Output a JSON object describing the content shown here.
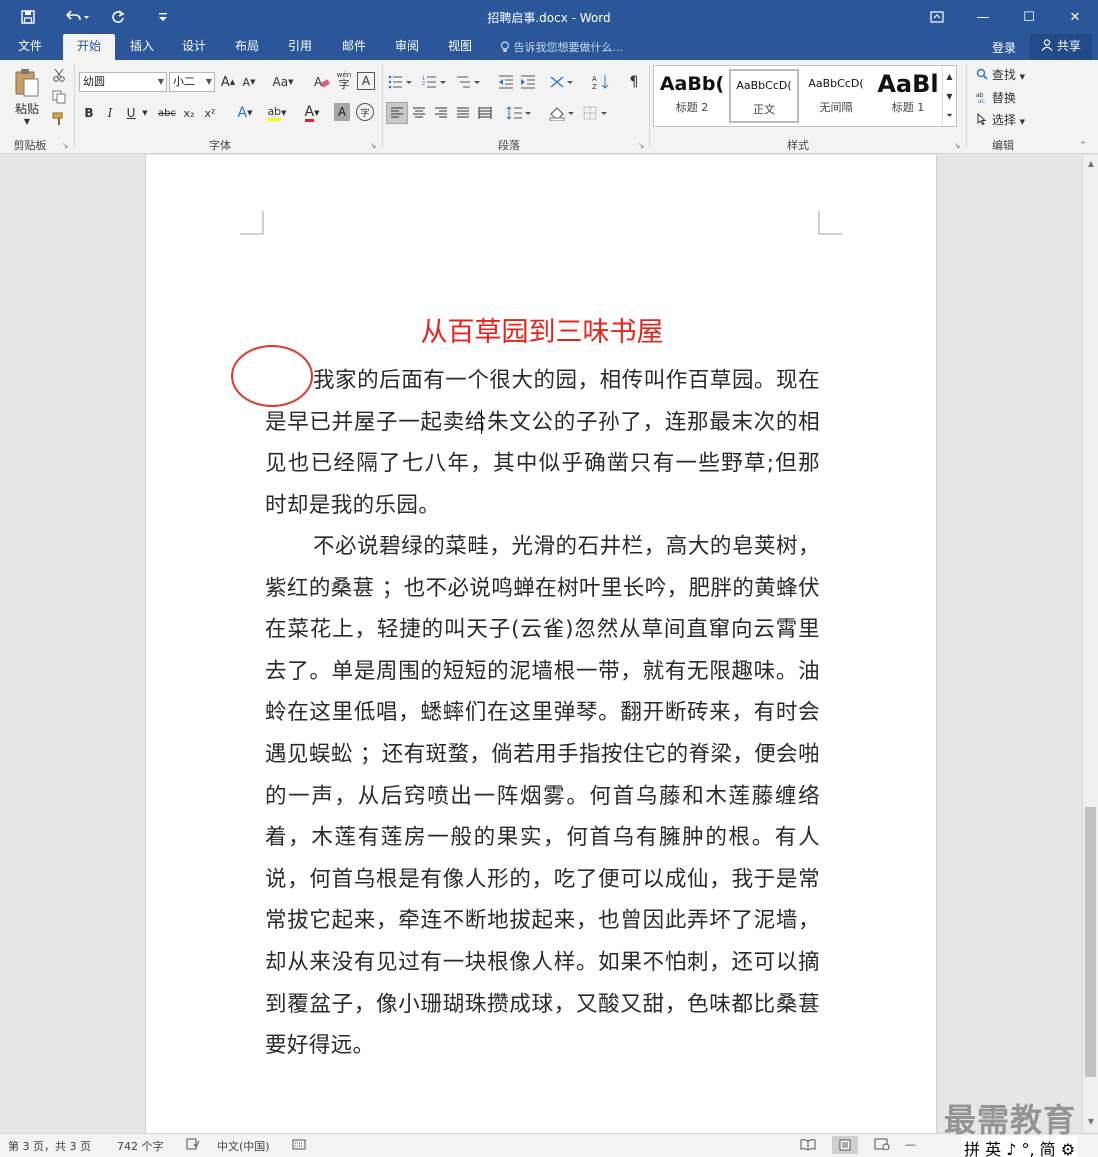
{
  "titlebar": {
    "title": "招聘启事.docx - Word",
    "save_icon": "save-icon",
    "undo_icon": "undo-icon",
    "redo_icon": "redo-icon",
    "customize_icon": "customize-qat-icon",
    "ribbon_display_icon": "ribbon-display-icon",
    "minimize": "—",
    "maximize": "☐",
    "close": "✕"
  },
  "tabs": [
    "文件",
    "开始",
    "插入",
    "设计",
    "布局",
    "引用",
    "邮件",
    "审阅",
    "视图"
  ],
  "active_tab": "开始",
  "tell_me": "告诉我您想要做什么...",
  "login": "登录",
  "share": "共享",
  "ribbon": {
    "clipboard": {
      "paste": "粘贴",
      "label": "剪贴板"
    },
    "font": {
      "font_name": "幼圆",
      "font_size": "小二",
      "label": "字体",
      "grow": "A",
      "shrink": "A",
      "case": "Aa",
      "bold": "B",
      "italic": "I",
      "underline": "U",
      "strike": "abc",
      "sub": "x₂",
      "sup": "x²",
      "effects": "A",
      "highlight": "ab",
      "color": "A",
      "shade": "A",
      "enclose": "字",
      "phonetic": "wén",
      "charborder": "A"
    },
    "paragraph": {
      "label": "段落"
    },
    "styles": {
      "label": "样式",
      "items": [
        {
          "preview": "AaBb(",
          "name": "标题 2"
        },
        {
          "preview": "AaBbCcD(",
          "name": "正文"
        },
        {
          "preview": "AaBbCcD(",
          "name": "无间隔"
        },
        {
          "preview": "AaBl",
          "name": "标题 1"
        }
      ]
    },
    "editing": {
      "find": "查找",
      "replace": "替换",
      "select": "选择",
      "label": "编辑"
    }
  },
  "document": {
    "title": "从百草园到三味书屋",
    "paragraphs": [
      "我家的后面有一个很大的园，相传叫作百草园。现在是早已并屋子一起卖给朱文公的子孙了，连那最末次的相见也已经隔了七八年，其中似乎确凿只有一些野草;但那时却是我的乐园。",
      "不必说碧绿的菜畦，光滑的石井栏，高大的皂荚树，紫红的桑葚 ；也不必说鸣蝉在树叶里长吟，肥胖的黄蜂伏在菜花上，轻捷的叫天子(云雀)忽然从草间直窜向云霄里去了。单是周围的短短的泥墙根一带，就有无限趣味。油蛉在这里低唱，蟋蟀们在这里弹琴。翻开断砖来，有时会遇见蜈蚣 ；还有斑蝥，倘若用手指按住它的脊梁，便会啪的一声，从后窍喷出一阵烟雾。何首乌藤和木莲藤缠络着，木莲有莲房一般的果实，何首乌有臃肿的根。有人说，何首乌根是有像人形的，吃了便可以成仙，我于是常常拔它起来，牵连不断地拔起来，也曾因此弄坏了泥墙，却从来没有见过有一块根像人样。如果不怕刺，还可以摘到覆盆子，像小珊瑚珠攒成球，又酸又甜，色味都比桑葚要好得远。"
    ]
  },
  "statusbar": {
    "page": "第 3 页，共 3 页",
    "words": "742 个字",
    "language": "中文(中国)",
    "ime": "英 ♪ °, 简 ⚙"
  },
  "watermark": "最需教育",
  "colors": {
    "brand": "#2b579a",
    "title_red": "#e8231b",
    "circle_red": "#e2352b"
  }
}
